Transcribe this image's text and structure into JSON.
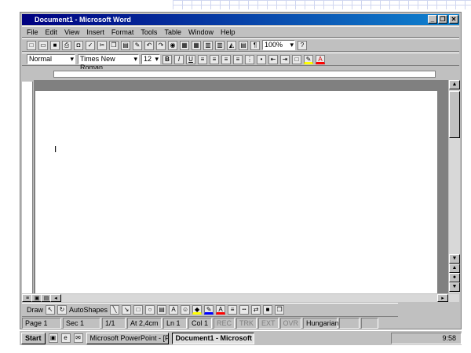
{
  "window": {
    "title": "Document1 - Microsoft Word",
    "minimize": "_",
    "maximize": "❐",
    "close": "✕"
  },
  "menu": [
    "File",
    "Edit",
    "View",
    "Insert",
    "Format",
    "Tools",
    "Table",
    "Window",
    "Help"
  ],
  "toolbar": {
    "zoom": "100%"
  },
  "format": {
    "style": "Normal",
    "font": "Times New Roman",
    "size": "12",
    "bold": "B",
    "italic": "I",
    "underline": "U"
  },
  "drawing": {
    "draw": "Draw",
    "autoshapes": "AutoShapes"
  },
  "status": {
    "page": "Page 1",
    "sec": "Sec 1",
    "pages": "1/1",
    "at": "At 2,4cm",
    "ln": "Ln 1",
    "col": "Col 1",
    "rec": "REC",
    "trk": "TRK",
    "ext": "EXT",
    "ovr": "OVR",
    "lang": "Hungarian"
  },
  "taskbar": {
    "start": "Start",
    "tasks": [
      "Microsoft PowerPoint - [Pr",
      "Document1 - Microsoft"
    ],
    "clock": "9:58"
  },
  "colors": {
    "titlebar": "#000080",
    "chrome": "#c0c0c0"
  }
}
